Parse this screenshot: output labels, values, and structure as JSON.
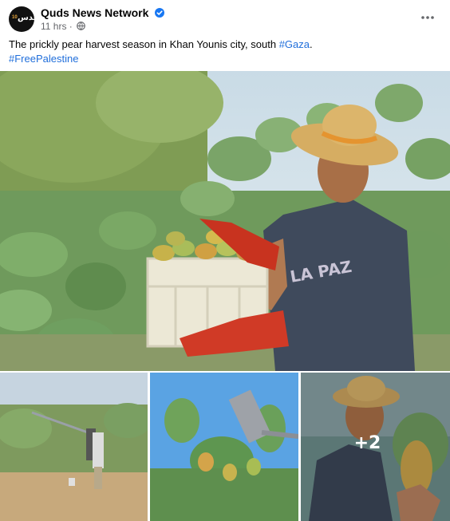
{
  "post": {
    "page_name": "Quds News Network",
    "avatar_text": "قدس",
    "avatar_number": "10",
    "timestamp": "11 hrs",
    "meta_separator": " · ",
    "caption_text": "The prickly pear harvest season in Khan Younis city, south ",
    "hashtag_gaza": "#Gaza",
    "caption_period": ".",
    "hashtag_free_palestine": "#FreePalestine",
    "more_photos_count": "+2"
  },
  "icons": {
    "verified": "verified-badge-icon",
    "audience": "globe-icon",
    "more": "more-options-icon"
  },
  "colors": {
    "hashtag": "#216fdb",
    "verified": "#1877f2",
    "secondary_text": "#65676b"
  }
}
